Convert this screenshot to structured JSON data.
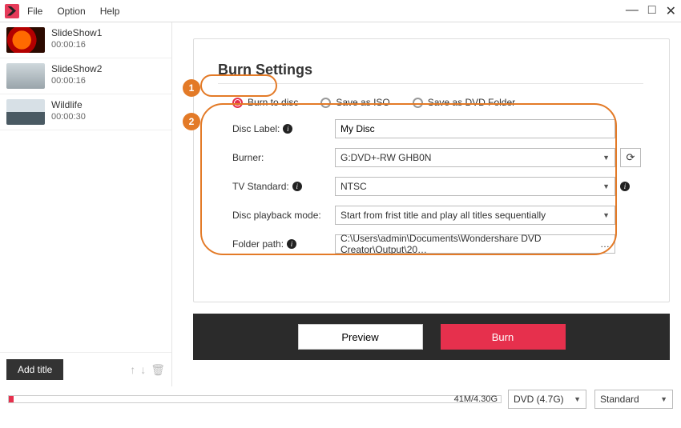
{
  "menu": {
    "file": "File",
    "option": "Option",
    "help": "Help"
  },
  "sidebar": {
    "items": [
      {
        "title": "SlideShow1",
        "duration": "00:00:16"
      },
      {
        "title": "SlideShow2",
        "duration": "00:00:16"
      },
      {
        "title": "Wildlife",
        "duration": "00:00:30"
      }
    ],
    "add_title": "Add title"
  },
  "panel": {
    "title": "Burn Settings",
    "radios": {
      "burn": "Burn to disc",
      "iso": "Save as ISO",
      "folder": "Save as DVD Folder"
    },
    "labels": {
      "disc_label": "Disc Label:",
      "burner": "Burner:",
      "tv": "TV Standard:",
      "playback": "Disc playback mode:",
      "folder": "Folder path:"
    },
    "values": {
      "disc_label": "My Disc",
      "burner": "G:DVD+-RW GHB0N",
      "tv": "NTSC",
      "playback": "Start from frist title and play all titles sequentially",
      "folder": "C:\\Users\\admin\\Documents\\Wondershare DVD Creator\\Output\\20…"
    },
    "preview": "Preview",
    "burn": "Burn",
    "callouts": {
      "one": "1",
      "two": "2"
    }
  },
  "footer": {
    "size": "41M/4.30G",
    "disc": "DVD (4.7G)",
    "quality": "Standard"
  }
}
